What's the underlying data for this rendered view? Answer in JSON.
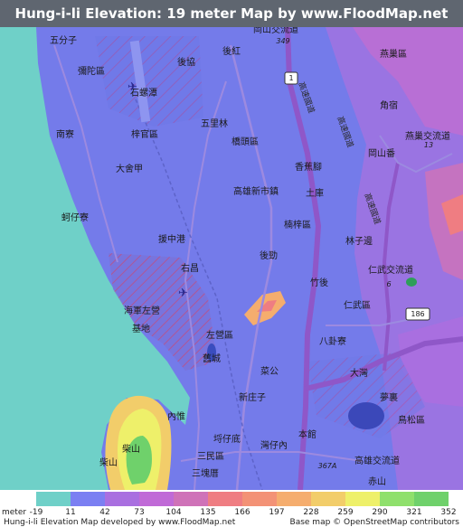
{
  "title": "Hung-i-li Elevation: 19 meter Map by www.FloodMap.net (beta)",
  "legend": {
    "unit": "meter",
    "colors": [
      "#6fd0c8",
      "#7b7ff2",
      "#a96fe0",
      "#c06ad7",
      "#cf72b8",
      "#ef7d82",
      "#f39276",
      "#f5ad6e",
      "#f2cd6a",
      "#eef06a",
      "#8fe06c",
      "#6fd16b"
    ],
    "ticks": [
      "-19",
      "11",
      "42",
      "73",
      "104",
      "135",
      "166",
      "197",
      "228",
      "259",
      "290",
      "321",
      "352"
    ]
  },
  "map": {
    "places": [
      {
        "name": "五分子"
      },
      {
        "name": "彌陀區"
      },
      {
        "name": "石螺潭"
      },
      {
        "name": "南寮"
      },
      {
        "name": "梓官區"
      },
      {
        "name": "大舍甲"
      },
      {
        "name": "蚵仔寮"
      },
      {
        "name": "援中港"
      },
      {
        "name": "右昌"
      },
      {
        "name": "海軍左營"
      },
      {
        "name": "基地"
      },
      {
        "name": "左營區"
      },
      {
        "name": "舊城"
      },
      {
        "name": "內惟"
      },
      {
        "name": "柴山"
      },
      {
        "name": "柴山"
      },
      {
        "name": "三塊厝"
      },
      {
        "name": "三民區"
      },
      {
        "name": "埒仔底"
      },
      {
        "name": "新庄子"
      },
      {
        "name": "菜公"
      },
      {
        "name": "灣仔內"
      },
      {
        "name": "本館"
      },
      {
        "name": "大灣"
      },
      {
        "name": "八卦寮"
      },
      {
        "name": "仁武區"
      },
      {
        "name": "竹後"
      },
      {
        "name": "後勁"
      },
      {
        "name": "楠梓區"
      },
      {
        "name": "高雄新市鎮"
      },
      {
        "name": "土庫"
      },
      {
        "name": "香蕉腳"
      },
      {
        "name": "橋頭區"
      },
      {
        "name": "五里林"
      },
      {
        "name": "後協"
      },
      {
        "name": "後紅"
      },
      {
        "name": "岡山交流道"
      },
      {
        "name": "燕巢區"
      },
      {
        "name": "角宿"
      },
      {
        "name": "燕巢交流道"
      },
      {
        "name": "岡山番"
      },
      {
        "name": "林子邊"
      },
      {
        "name": "仁武交流道"
      },
      {
        "name": "夢裏"
      },
      {
        "name": "鳥松區"
      },
      {
        "name": "赤山"
      },
      {
        "name": "高雄交流道"
      },
      {
        "name": "高速國道"
      },
      {
        "name": "高速國道"
      },
      {
        "name": "高速國道"
      }
    ],
    "shields": [
      {
        "label": "349"
      },
      {
        "label": "1"
      },
      {
        "label": "13"
      },
      {
        "label": "6"
      },
      {
        "label": "186"
      },
      {
        "label": "367A"
      }
    ]
  },
  "footer": {
    "left": "Hung-i-li Elevation Map developed by www.FloodMap.net",
    "right": "Base map © OpenStreetMap contributors"
  }
}
